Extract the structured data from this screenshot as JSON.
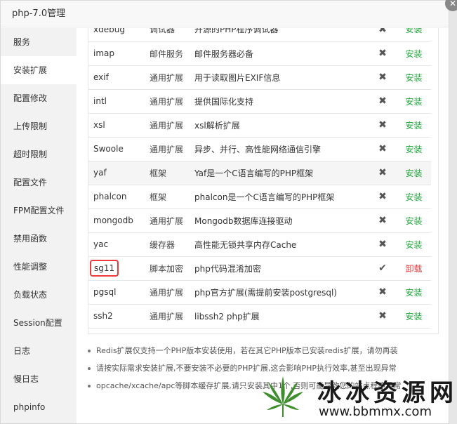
{
  "window": {
    "title": "php-7.0管理",
    "close_glyph": "✕"
  },
  "sidebar": {
    "items": [
      {
        "label": "服务"
      },
      {
        "label": "安装扩展"
      },
      {
        "label": "配置修改"
      },
      {
        "label": "上传限制"
      },
      {
        "label": "超时限制"
      },
      {
        "label": "配置文件"
      },
      {
        "label": "FPM配置文件"
      },
      {
        "label": "禁用函数"
      },
      {
        "label": "性能调整"
      },
      {
        "label": "负载状态"
      },
      {
        "label": "Session配置"
      },
      {
        "label": "日志"
      },
      {
        "label": "慢日志"
      },
      {
        "label": "phpinfo"
      }
    ]
  },
  "extensions": {
    "rows": [
      {
        "name": "xdebug",
        "type": "调试器",
        "desc": "开源的PHP程序调试器",
        "status": "✖",
        "action": "安装"
      },
      {
        "name": "imap",
        "type": "邮件服务",
        "desc": "邮件服务器必备",
        "status": "✖",
        "action": "安装"
      },
      {
        "name": "exif",
        "type": "通用扩展",
        "desc": "用于读取图片EXIF信息",
        "status": "✖",
        "action": "安装"
      },
      {
        "name": "intl",
        "type": "通用扩展",
        "desc": "提供国际化支持",
        "status": "✖",
        "action": "安装"
      },
      {
        "name": "xsl",
        "type": "通用扩展",
        "desc": "xsl解析扩展",
        "status": "✖",
        "action": "安装"
      },
      {
        "name": "Swoole",
        "type": "通用扩展",
        "desc": "异步、并行、高性能网络通信引擎",
        "status": "✖",
        "action": "安装"
      },
      {
        "name": "yaf",
        "type": "框架",
        "desc": "Yaf是一个C语言编写的PHP框架",
        "status": "✖",
        "action": "安装"
      },
      {
        "name": "phalcon",
        "type": "框架",
        "desc": "phalcon是一个C语言编写的PHP框架",
        "status": "✖",
        "action": "安装"
      },
      {
        "name": "mongodb",
        "type": "通用扩展",
        "desc": "Mongodb数据库连接驱动",
        "status": "✖",
        "action": "安装"
      },
      {
        "name": "yac",
        "type": "缓存器",
        "desc": "高性能无锁共享内存Cache",
        "status": "✖",
        "action": "安装"
      },
      {
        "name": "sg11",
        "type": "脚本加密",
        "desc": "php代码混淆加密",
        "status": "✔",
        "action": "卸载"
      },
      {
        "name": "pgsql",
        "type": "通用扩展",
        "desc": "php官方扩展(需提前安装postgresql)",
        "status": "✖",
        "action": "安装"
      },
      {
        "name": "ssh2",
        "type": "通用扩展",
        "desc": "libssh2 php扩展",
        "status": "✖",
        "action": "安装"
      }
    ]
  },
  "notes": [
    "Redis扩展仅支持一个PHP版本安装使用，若在其它PHP版本已安装redis扩展，请勿再装",
    "请按实际需求安装扩展,不要安装不必要的PHP扩展,这会影响PHP执行效率,甚至出现异常",
    "opcache/xcache/apc等脚本缓存扩展,请只安装其中1个,否则可能导致您的站点程序异常"
  ],
  "watermark": {
    "title": "冰冰资源网",
    "url": "www.bbmmx.com",
    "icon": "cannabis-leaf-icon"
  },
  "colors": {
    "install": "#20a53a",
    "uninstall": "#f0393b",
    "highlight_box": "#f0393b"
  }
}
